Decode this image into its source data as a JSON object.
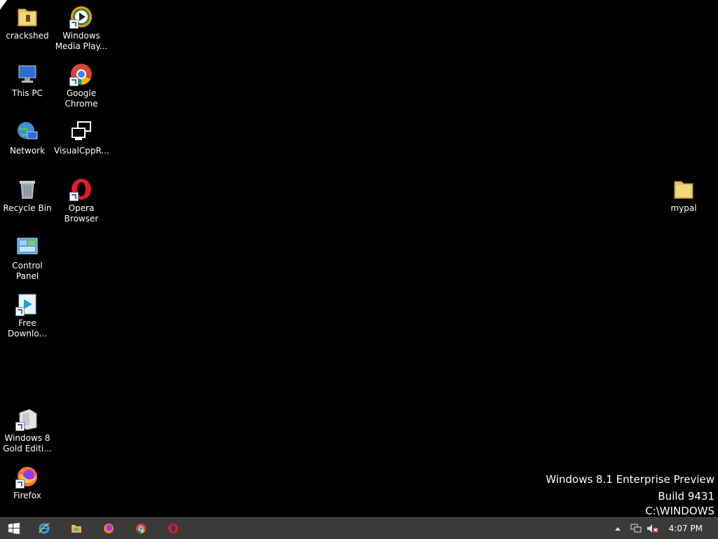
{
  "desktop": {
    "icons": [
      {
        "label": "crackshed",
        "icon": "folder-icon"
      },
      {
        "label": "Windows Media Play...",
        "icon": "windows-media-player-icon"
      },
      {
        "label": "This PC",
        "icon": "this-pc-icon"
      },
      {
        "label": "Google Chrome",
        "icon": "chrome-icon"
      },
      {
        "label": "Network",
        "icon": "network-icon"
      },
      {
        "label": "VisualCppR...",
        "icon": "program-icon"
      },
      {
        "label": "Recycle Bin",
        "icon": "recycle-bin-icon"
      },
      {
        "label": "Opera Browser",
        "icon": "opera-icon"
      },
      {
        "label": "Control Panel",
        "icon": "control-panel-icon"
      },
      {
        "label": "Free Downlo...",
        "icon": "free-download-manager-icon"
      },
      {
        "label": "Windows 8 Gold Editi...",
        "icon": "windows-8-gold-icon"
      },
      {
        "label": "Firefox",
        "icon": "firefox-icon"
      },
      {
        "label": "mypal",
        "icon": "folder-icon"
      }
    ]
  },
  "watermark": {
    "line1": "Windows 8.1 Enterprise Preview",
    "line2": "Build 9431",
    "line3": "C:\\WINDOWS"
  },
  "taskbar": {
    "pinned": [
      "start-icon",
      "internet-explorer-icon",
      "file-explorer-icon",
      "firefox-icon",
      "chrome-icon",
      "opera-icon"
    ],
    "tray": [
      "show-hidden-icons-icon",
      "network-tray-icon",
      "volume-muted-icon"
    ],
    "clock": "4:07 PM"
  }
}
